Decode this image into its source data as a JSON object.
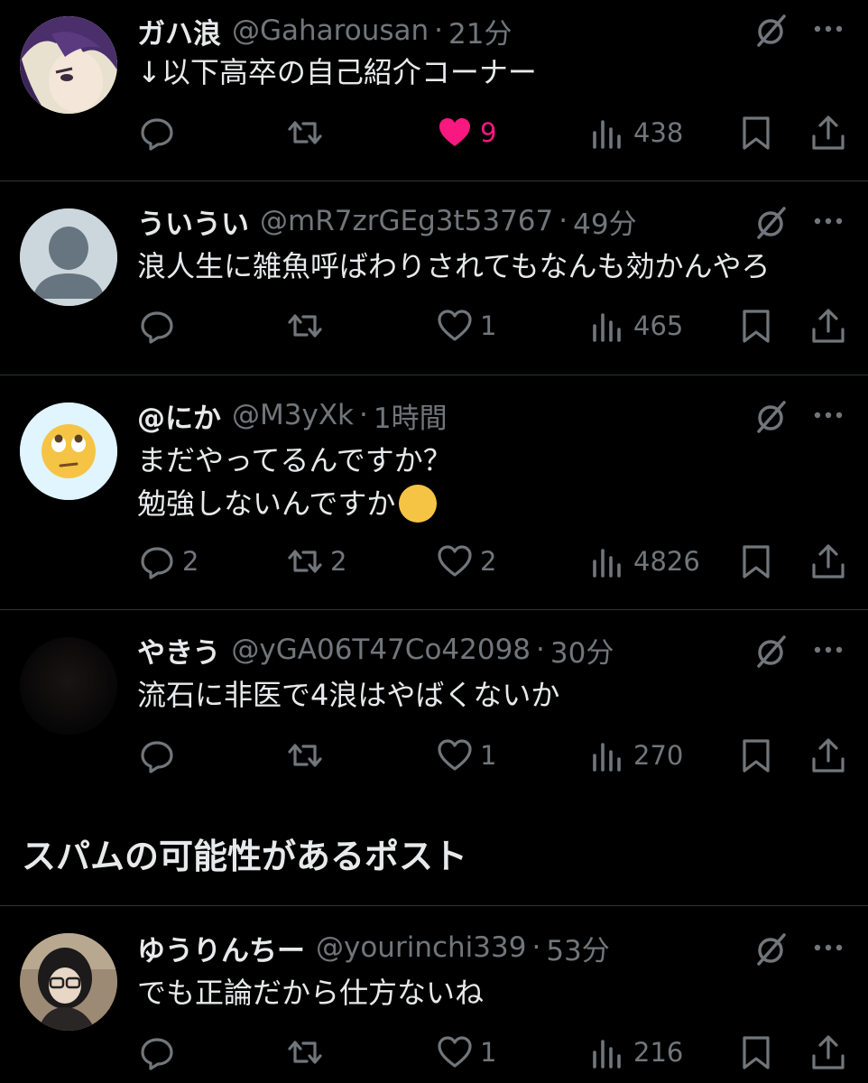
{
  "tweets": [
    {
      "name": "ガハ浪",
      "handle": "@Gaharousan",
      "time": "21分",
      "lines": [
        "↓以下高卒の自己紹介コーナー"
      ],
      "replies": "",
      "retweets": "",
      "likes": "9",
      "liked": true,
      "views": "438",
      "avatar": "anime-avatar"
    },
    {
      "name": "ういうい",
      "handle": "@mR7zrGEg3t53767",
      "time": "49分",
      "lines": [
        "浪人生に雑魚呼ばわりされてもなんも効かんやろ"
      ],
      "replies": "",
      "retweets": "",
      "likes": "1",
      "liked": false,
      "views": "465",
      "avatar": "default-avatar"
    },
    {
      "name": "@にか",
      "handle": "@M3yXk",
      "time": "1時間",
      "lines": [
        "まだやってるんですか？",
        "勉強しないんですか"
      ],
      "emoji": "😆",
      "replies": "2",
      "retweets": "2",
      "likes": "2",
      "liked": false,
      "views": "4826",
      "avatar": "eye-roll-emoji-avatar"
    },
    {
      "name": "やきう",
      "handle": "@yGA06T47Co42098",
      "time": "30分",
      "lines": [
        "流石に非医で4浪はやばくないか"
      ],
      "replies": "",
      "retweets": "",
      "likes": "1",
      "liked": false,
      "views": "270",
      "avatar": "dark-avatar"
    }
  ],
  "section_title": "スパムの可能性があるポスト",
  "spam_tweet": {
    "name": "ゆうりんちー",
    "handle": "@yourinchi339",
    "time": "53分",
    "lines": [
      "でも正論だから仕方ないね"
    ],
    "replies": "",
    "retweets": "",
    "likes": "1",
    "liked": false,
    "views": "216",
    "avatar": "photo-avatar"
  },
  "separator": "·",
  "colors": {
    "background": "#000000",
    "text": "#e7e9ea",
    "muted": "#71767b",
    "like": "#f91880",
    "divider": "#2f3336"
  },
  "icons": [
    "reply-icon",
    "retweet-icon",
    "like-icon",
    "views-icon",
    "bookmark-icon",
    "share-icon",
    "grok-icon",
    "more-icon"
  ]
}
